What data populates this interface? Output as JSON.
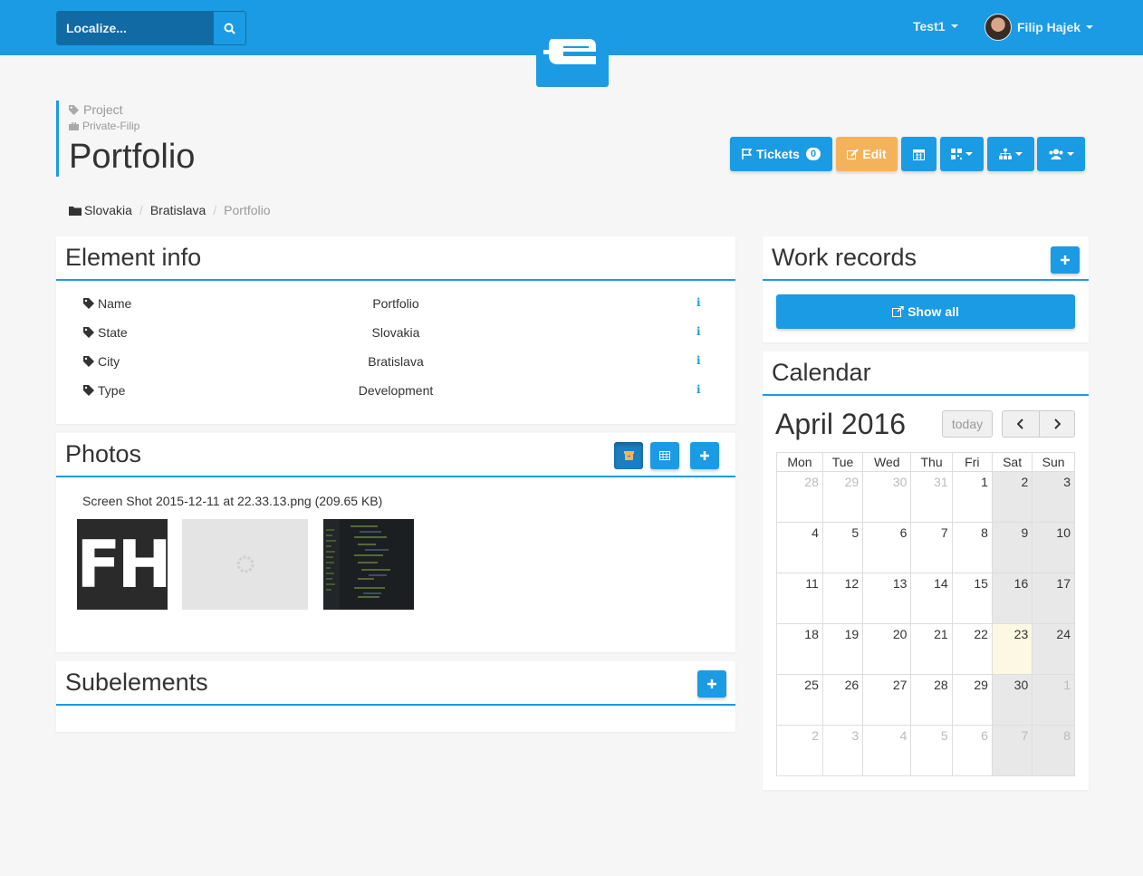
{
  "navbar": {
    "search_placeholder": "Localize...",
    "project_menu": "Test1",
    "user_menu": "Filip Hajek"
  },
  "header": {
    "crumb_type": "Project",
    "crumb_owner": "Private-Filip",
    "title": "Portfolio"
  },
  "toolbar": {
    "tickets_label": "Tickets",
    "tickets_count": "0",
    "edit_label": "Edit"
  },
  "breadcrumb": [
    "Slovakia",
    "Bratislava",
    "Portfolio"
  ],
  "element_info": {
    "title": "Element info",
    "rows": [
      {
        "label": "Name",
        "value": "Portfolio"
      },
      {
        "label": "State",
        "value": "Slovakia"
      },
      {
        "label": "City",
        "value": "Bratislava"
      },
      {
        "label": "Type",
        "value": "Development"
      }
    ],
    "info_glyph": "i"
  },
  "photos": {
    "title": "Photos",
    "file_caption": "Screen Shot 2015-12-11 at 22.33.13.png (209.65 KB)",
    "thumbnail_text": "FH"
  },
  "subelements": {
    "title": "Subelements"
  },
  "work_records": {
    "title": "Work records",
    "show_all": "Show all"
  },
  "calendar": {
    "title": "Calendar",
    "month_label": "April 2016",
    "today_label": "today",
    "weekdays": [
      "Mon",
      "Tue",
      "Wed",
      "Thu",
      "Fri",
      "Sat",
      "Sun"
    ],
    "weeks": [
      [
        "28",
        "29",
        "30",
        "31",
        "1",
        "2",
        "3"
      ],
      [
        "4",
        "5",
        "6",
        "7",
        "8",
        "9",
        "10"
      ],
      [
        "11",
        "12",
        "13",
        "14",
        "15",
        "16",
        "17"
      ],
      [
        "18",
        "19",
        "20",
        "21",
        "22",
        "23",
        "24"
      ],
      [
        "25",
        "26",
        "27",
        "28",
        "29",
        "30",
        "1"
      ],
      [
        "2",
        "3",
        "4",
        "5",
        "6",
        "7",
        "8"
      ]
    ],
    "today": "23"
  }
}
